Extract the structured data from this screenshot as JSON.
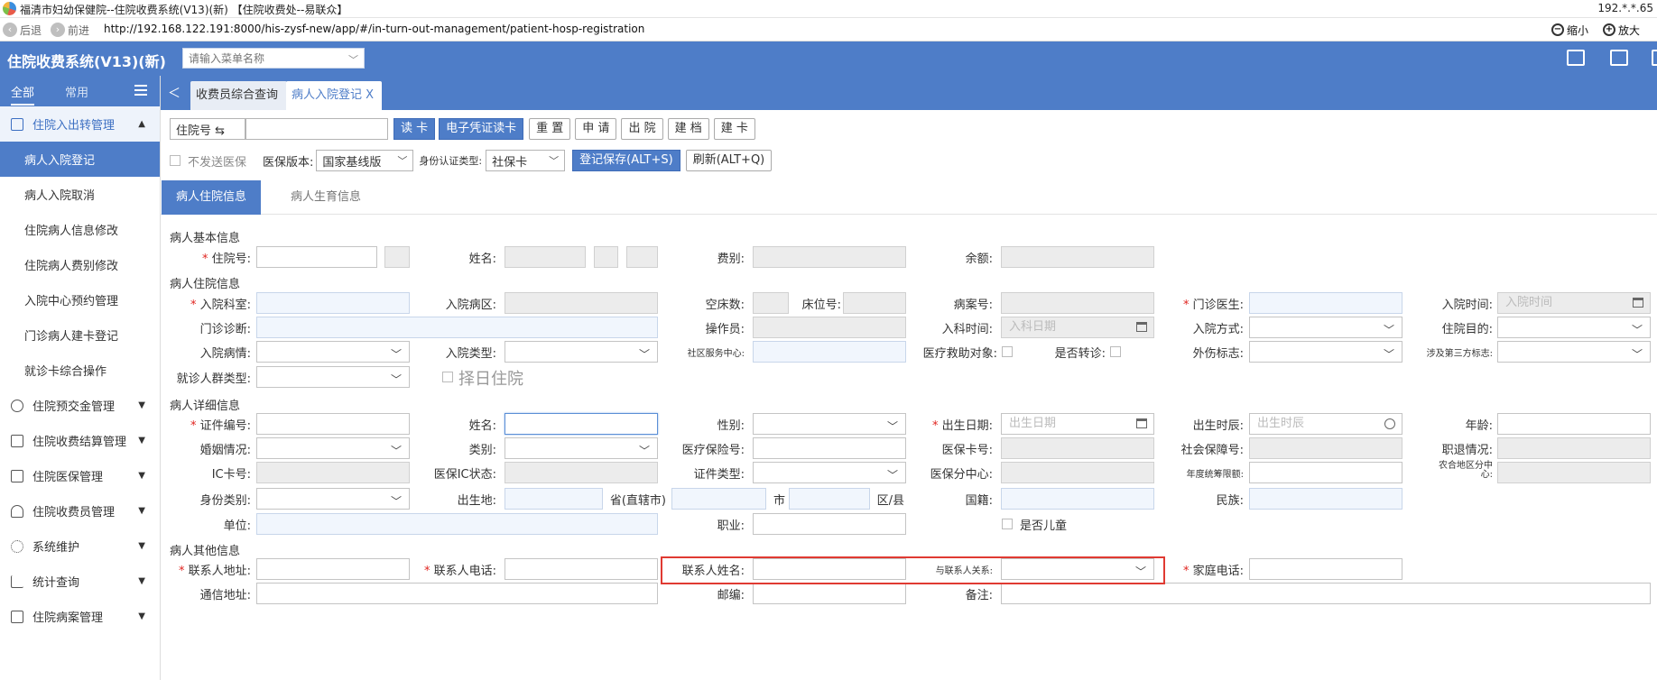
{
  "window": {
    "title": "福清市妇幼保健院--住院收费系统(V13)(新) 【住院收费处--易联众】",
    "ip": "192.*.*.65",
    "back": "后退",
    "forward": "前进",
    "url": "http://192.168.122.191:8000/his-zysf-new/app/#/in-turn-out-management/patient-hosp-registration",
    "zoom_out": "缩小",
    "zoom_in": "放大"
  },
  "header": {
    "app_title": "住院收费系统(V13)(新)",
    "menu_search_placeholder": "请输入菜单名称"
  },
  "sidebar": {
    "tab_all": "全部",
    "tab_common": "常用",
    "groups": [
      {
        "label": "住院入出转管理",
        "icon": "bed-icon",
        "open": true
      },
      {
        "label": "住院预交金管理",
        "icon": "coin-icon"
      },
      {
        "label": "住院收费结算管理",
        "icon": "receipt-icon"
      },
      {
        "label": "住院医保管理",
        "icon": "card-icon"
      },
      {
        "label": "住院收费员管理",
        "icon": "user-icon"
      },
      {
        "label": "系统维护",
        "icon": "gear-icon"
      },
      {
        "label": "统计查询",
        "icon": "chart-icon"
      },
      {
        "label": "住院病案管理",
        "icon": "folder-icon"
      }
    ],
    "subitems": [
      "病人入院登记",
      "病人入院取消",
      "住院病人信息修改",
      "住院病人费别修改",
      "入院中心预约管理",
      "门诊病人建卡登记",
      "就诊卡综合操作"
    ],
    "active_sub": "病人入院登记"
  },
  "tabs": {
    "tab1": "收费员综合查询",
    "tab2": "病人入院登记",
    "close": "X"
  },
  "toolbar": {
    "hosp_no_select": "住院号 ⇆",
    "read_card": "读 卡",
    "e_voucher": "电子凭证读卡",
    "reset": "重 置",
    "apply": "申 请",
    "discharge": "出 院",
    "archive": "建 档",
    "create_card": "建 卡",
    "no_send_insurance": "不发送医保",
    "insurance_version_label": "医保版本:",
    "insurance_version_value": "国家基线版",
    "id_auth_label": "身份认证类型:",
    "id_auth_value": "社保卡",
    "save": "登记保存(ALT+S)",
    "refresh": "刷新(ALT+Q)"
  },
  "form_tabs": {
    "tab1": "病人住院信息",
    "tab2": "病人生育信息"
  },
  "form": {
    "sec_basic": "病人基本信息",
    "sec_hosp": "病人住院信息",
    "sec_detail": "病人详细信息",
    "sec_other": "病人其他信息",
    "hosp_no": "住院号",
    "name": "姓名",
    "fee_type": "费别",
    "balance": "余额",
    "admit_dept": "入院科室",
    "admit_ward": "入院病区",
    "empty_beds": "空床数",
    "bed_no": "床位号",
    "case_no": "病案号",
    "op_doctor": "门诊医生",
    "admit_time": "入院时间",
    "admit_time_ph": "入院时间",
    "op_diag": "门诊诊断",
    "operator": "操作员",
    "dept_time": "入科时间",
    "dept_date_ph": "入科日期",
    "admit_way": "入院方式",
    "hosp_purpose": "住院目的",
    "admit_cond": "入院病情",
    "admit_type": "入院类型",
    "community_center": "社区服务中心",
    "aid_target": "医疗救助对象",
    "is_transfer": "是否转诊",
    "injury_flag": "外伤标志",
    "third_party": "涉及第三方标志",
    "crowd_type": "就诊人群类型",
    "select_day": "择日住院",
    "id_no": "证件编号",
    "name2": "姓名",
    "gender": "性别",
    "birth_date": "出生日期",
    "birth_date_ph": "出生日期",
    "birth_hour": "出生时辰",
    "birth_hour_ph": "出生时辰",
    "age": "年龄",
    "marital": "婚姻情况",
    "category": "类别",
    "ins_no": "医疗保险号",
    "ins_card": "医保卡号",
    "social_no": "社会保障号",
    "job_status": "职退情况",
    "ic_card": "IC卡号",
    "ins_ic_status": "医保IC状态",
    "cert_type": "证件类型",
    "ins_center": "医保分中心",
    "annual_limit": "年度统筹限额",
    "rural_center": "农合地区分中心",
    "id_category": "身份类别",
    "birthplace": "出生地",
    "province": "省(直辖市)",
    "city": "市",
    "district": "区/县",
    "nationality": "国籍",
    "ethnicity": "民族",
    "employer": "单位",
    "occupation": "职业",
    "is_child": "是否儿童",
    "contact_addr": "联系人地址",
    "contact_phone": "联系人电话",
    "contact_name": "联系人姓名",
    "contact_relation": "与联系人关系",
    "home_phone": "家庭电话",
    "mail_addr": "通信地址",
    "postcode": "邮编",
    "remark": "备注"
  },
  "colors": {
    "primary": "#4e7dc8",
    "required": "#e0241f",
    "highlight_box": "#e03a32"
  }
}
